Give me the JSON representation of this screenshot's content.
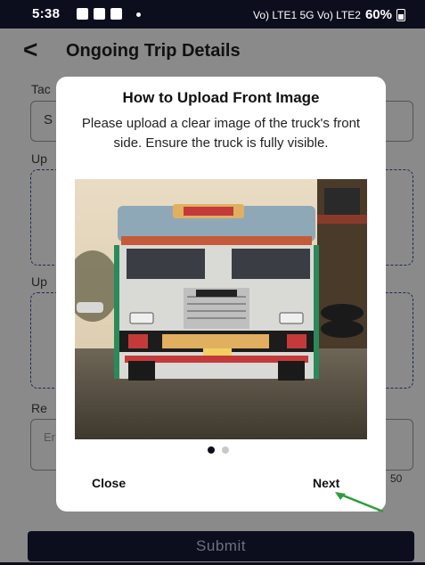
{
  "status_bar": {
    "time": "5:38",
    "signal_text": "Vo) LTE1 5G Vo) LTE2",
    "battery": "60%"
  },
  "appbar": {
    "back_glyph": "<",
    "title": "Ongoing Trip Details"
  },
  "background_form": {
    "tag_label_partial": "Tac",
    "tag_value_partial": "S",
    "upload_label_1_partial": "Up",
    "upload_label_2_partial": "Up",
    "remarks_label_partial": "Re",
    "remarks_placeholder_partial": "Er",
    "char_count_partial": "50",
    "submit_label": "Submit"
  },
  "modal": {
    "title": "How to Upload Front Image",
    "description": "Please upload a clear image of the truck's front side. Ensure the truck is fully visible.",
    "image_icon": "truck-front-photo",
    "pagination": {
      "current": 1,
      "total": 2
    },
    "close_label": "Close",
    "next_label": "Next"
  },
  "annotation": {
    "arrow_color": "#2e9e3a"
  },
  "colors": {
    "dark": "#0c0d1d",
    "overlay": "#8a8a8a"
  }
}
